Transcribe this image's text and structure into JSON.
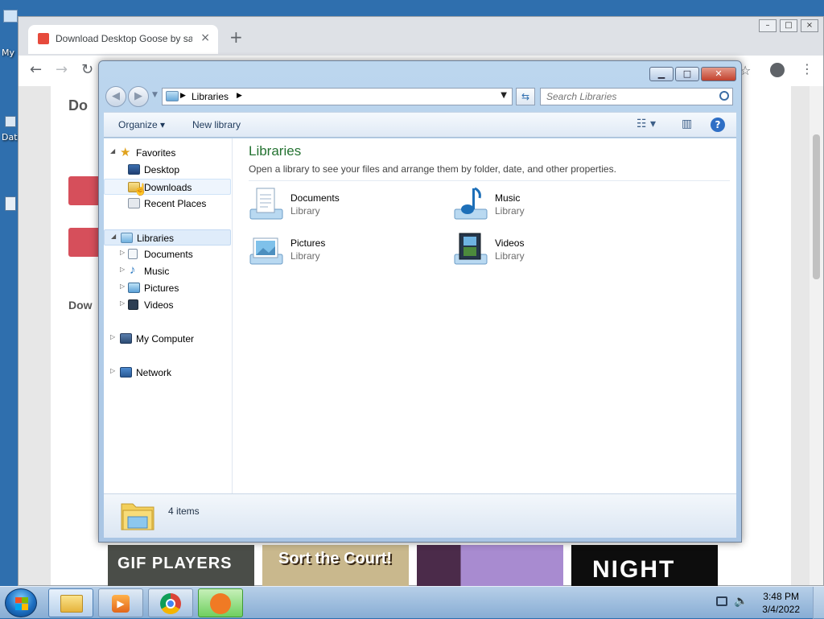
{
  "desktop": {
    "icons": [
      {
        "label": "My"
      },
      {
        "label": "Dat"
      }
    ]
  },
  "browser": {
    "tab_title": "Download Desktop Goose by samperson",
    "tab_close": "×",
    "new_tab": "+",
    "window_buttons": [
      "–",
      "□",
      "×"
    ],
    "back": "←",
    "forward": "→",
    "reload": "↻",
    "page_heading": "Do",
    "page_section": "Dow",
    "thumbnails": [
      {
        "text": "GIF  PLAYERS",
        "bg": "#4a4d48",
        "fg": "#ffffff"
      },
      {
        "text": "Sort the Court!",
        "bg": "#c9b88d",
        "fg": "#ffffff"
      },
      {
        "text": "",
        "bg": "#8f6bb0",
        "fg": "#ffffff"
      },
      {
        "text": "NIGHT",
        "bg": "#0d0d0d",
        "fg": "#ffffff"
      }
    ]
  },
  "explorer": {
    "caption_buttons": [
      "▁",
      "□",
      "✕"
    ],
    "breadcrumb": "Libraries",
    "search_placeholder": "Search Libraries",
    "commands": {
      "organize": "Organize ▾",
      "new_library": "New library"
    },
    "help": "?",
    "nav": {
      "favorites": "Favorites",
      "desktop": "Desktop",
      "downloads": "Downloads",
      "recent_places": "Recent Places",
      "libraries": "Libraries",
      "documents": "Documents",
      "music": "Music",
      "pictures": "Pictures",
      "videos": "Videos",
      "my_computer": "My Computer",
      "network": "Network"
    },
    "main": {
      "title": "Libraries",
      "description": "Open a library to see your files and arrange them by folder, date, and other properties.",
      "libraries": [
        {
          "name": "Documents",
          "type": "Library"
        },
        {
          "name": "Music",
          "type": "Library"
        },
        {
          "name": "Pictures",
          "type": "Library"
        },
        {
          "name": "Videos",
          "type": "Library"
        }
      ]
    },
    "status": "4 items"
  },
  "taskbar": {
    "time": "3:48 PM",
    "date": "3/4/2022"
  },
  "colors": {
    "library_title": "#247231",
    "accent_blue": "#2f6fb0"
  }
}
